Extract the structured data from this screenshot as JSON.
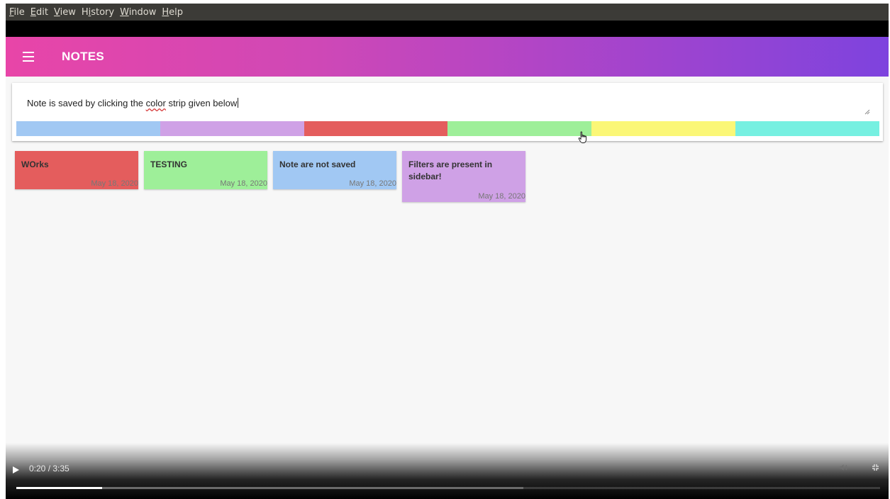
{
  "menu": [
    {
      "label": "File",
      "mn": "F",
      "rest": "ile"
    },
    {
      "label": "Edit",
      "mn": "E",
      "rest": "dit"
    },
    {
      "label": "View",
      "mn": "V",
      "rest": "iew"
    },
    {
      "label": "History",
      "pre": "H",
      "mn": "i",
      "rest": "story"
    },
    {
      "label": "Window",
      "mn": "W",
      "rest": "indow"
    },
    {
      "label": "Help",
      "mn": "H",
      "rest": "elp"
    }
  ],
  "appbar": {
    "title": "NOTES",
    "menu_icon": "hamburger-icon"
  },
  "composer": {
    "text_before": "Note is saved by clicking the ",
    "misspelled": "color",
    "text_after": " strip given below",
    "colors": [
      "#a1c8f3",
      "#cfa1e6",
      "#e45d5d",
      "#9eef99",
      "#fbf777",
      "#76f0e1"
    ]
  },
  "notes": [
    {
      "title": "WOrks",
      "date": "May 18, 2020",
      "color": "#e45d5d"
    },
    {
      "title": "TESTING",
      "date": "May 18, 2020",
      "color": "#9eef99"
    },
    {
      "title": "Note are not saved",
      "date": "May 18, 2020",
      "color": "#a1c8f3"
    },
    {
      "title": "Filters are present in sidebar!",
      "date": "May 18, 2020",
      "color": "#cfa1e6"
    }
  ],
  "video": {
    "time": "0:20 / 3:35",
    "played_fraction": 0.099,
    "buffered_fraction": 0.587,
    "volume_icon": "volume-icon",
    "fullscreen_icon": "exit-fullscreen-icon"
  }
}
